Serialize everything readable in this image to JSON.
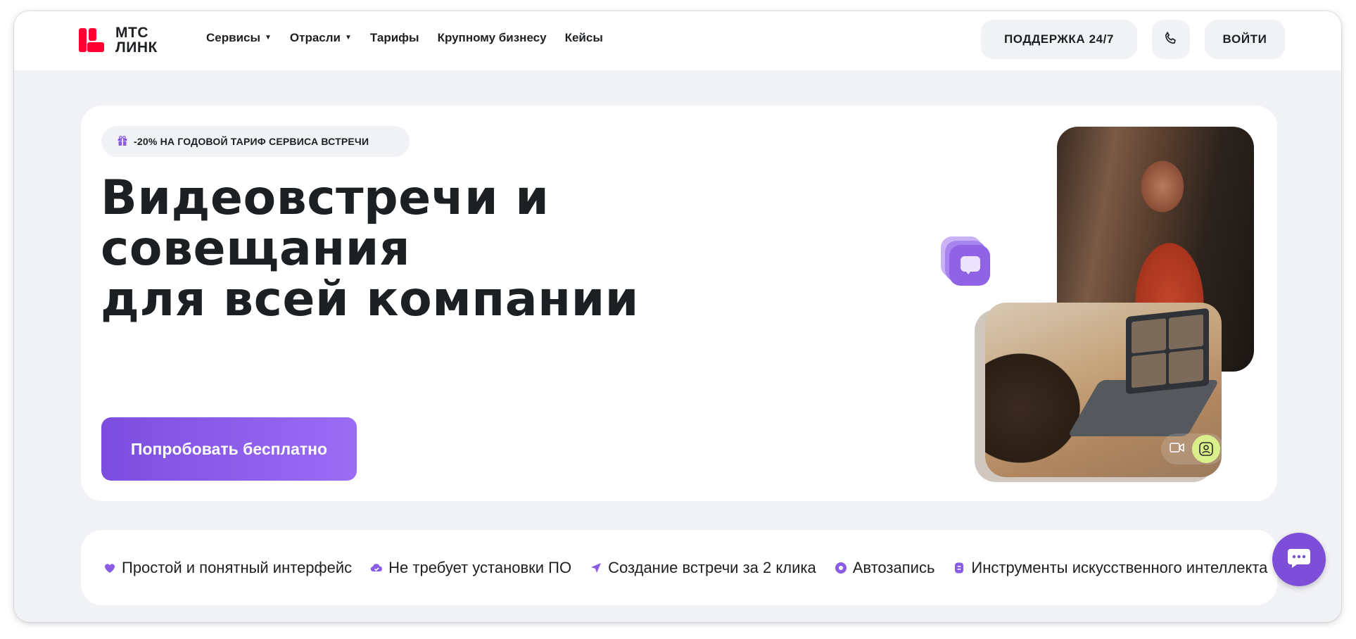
{
  "brand": {
    "line1": "МТС",
    "line2": "ЛИНК",
    "color": "#ff0032"
  },
  "nav": [
    {
      "label": "Сервисы",
      "dropdown": true
    },
    {
      "label": "Отрасли",
      "dropdown": true
    },
    {
      "label": "Тарифы",
      "dropdown": false
    },
    {
      "label": "Крупному бизнесу",
      "dropdown": false
    },
    {
      "label": "Кейсы",
      "dropdown": false
    }
  ],
  "header": {
    "support_label": "ПОДДЕРЖКА 24/7",
    "phone_icon": "phone-icon",
    "login_label": "ВОЙТИ"
  },
  "hero": {
    "promo": "-20% НА ГОДОВОЙ ТАРИФ СЕРВИСА ВСТРЕЧИ",
    "title_line1": "Видеовстречи и совещания",
    "title_line2": "для всей компании",
    "cta": "Попробовать бесплатно"
  },
  "features": [
    {
      "icon": "heart-icon",
      "label": "Простой и понятный интерфейс"
    },
    {
      "icon": "cloud-check-icon",
      "label": "Не требует установки ПО"
    },
    {
      "icon": "send-icon",
      "label": "Создание встречи за 2 клика"
    },
    {
      "icon": "record-icon",
      "label": "Автозапись"
    },
    {
      "icon": "ai-icon",
      "label": "Инструменты искусственного интеллекта"
    }
  ],
  "colors": {
    "accent": "#7d4fd8",
    "background": "#f1f2f6",
    "text": "#1d2023"
  }
}
